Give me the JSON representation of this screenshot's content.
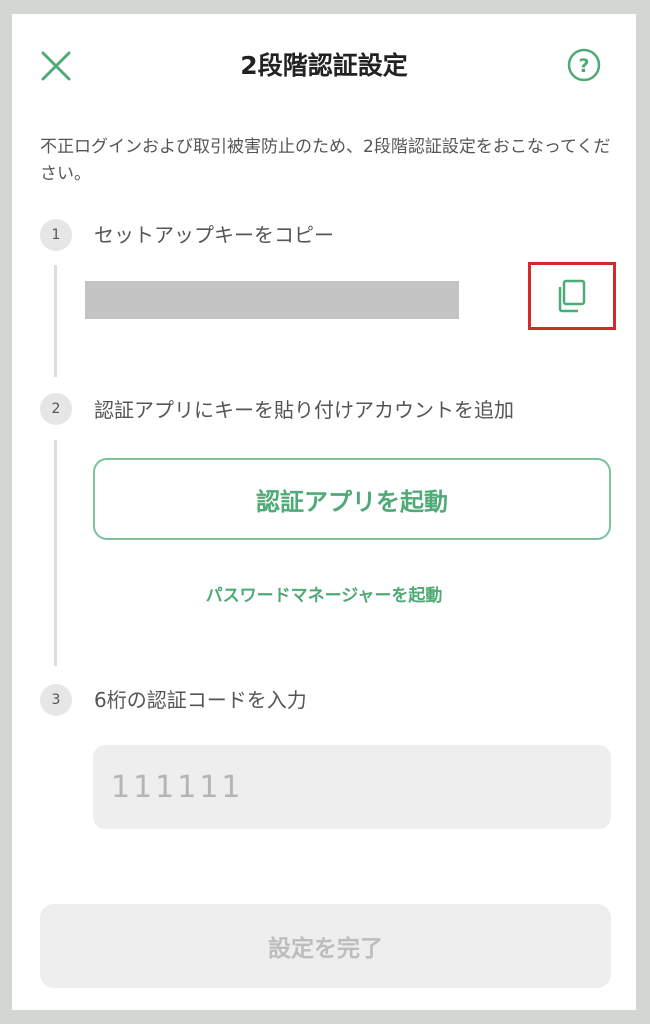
{
  "header": {
    "title": "2段階認証設定",
    "close_icon": "close-icon",
    "help_icon": "help-circle-icon"
  },
  "intro_text": "不正ログインおよび取引被害防止のため、2段階認証設定をおこなってください。",
  "steps": [
    {
      "number": "1",
      "label": "セットアップキーをコピー"
    },
    {
      "number": "2",
      "label": "認証アプリにキーを貼り付けアカウントを追加"
    },
    {
      "number": "3",
      "label": "6桁の認証コードを入力"
    }
  ],
  "copy": {
    "icon": "copy-icon"
  },
  "launch_app_button": "認証アプリを起動",
  "password_manager_link": "パスワードマネージャーを起動",
  "code_input": {
    "placeholder": "111111",
    "value": ""
  },
  "submit_button": "設定を完了",
  "colors": {
    "accent": "#4eaa77",
    "accent_border": "#7cc29a",
    "highlight": "#d12b2b",
    "masked": "#c4c4c4",
    "disabled_bg": "#eeeeee"
  }
}
